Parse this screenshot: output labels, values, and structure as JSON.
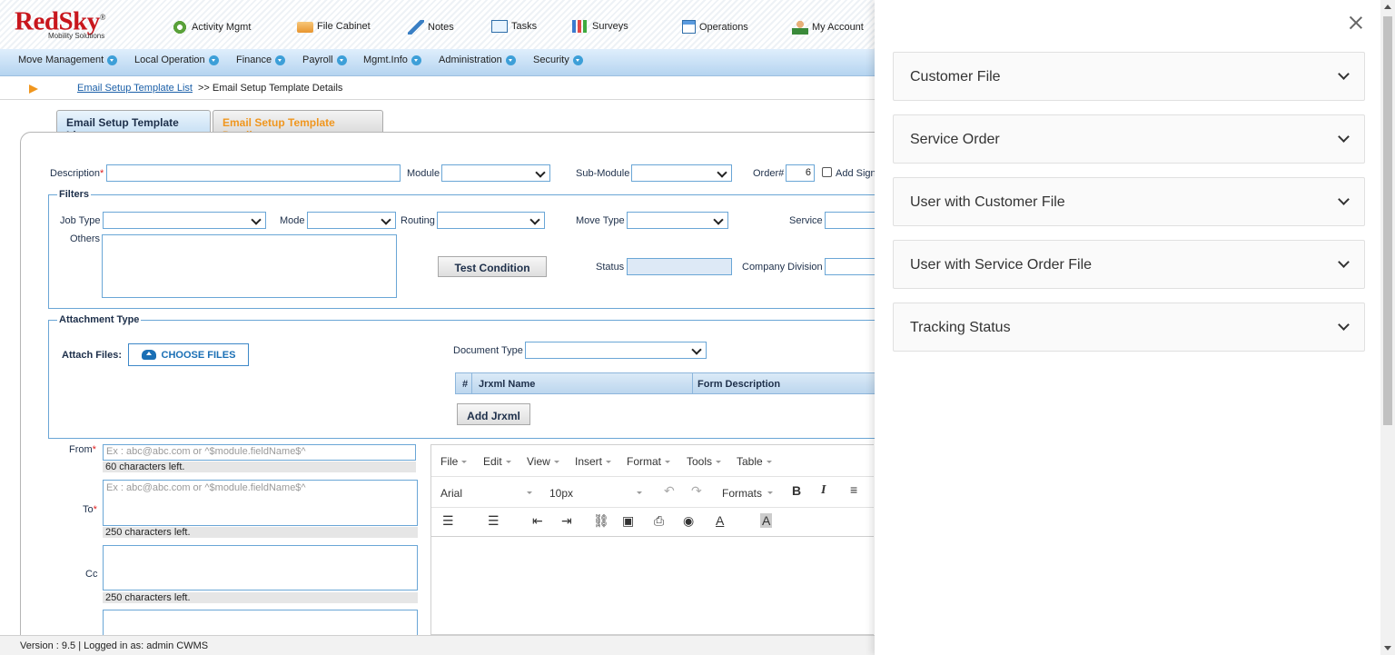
{
  "brand": {
    "name": "RedSky",
    "reg": "®",
    "tagline": "Mobility Solutions"
  },
  "topnav": [
    {
      "label": "Activity Mgmt",
      "icon": "gear-icon"
    },
    {
      "label": "File Cabinet",
      "icon": "folder-icon"
    },
    {
      "label": "Notes",
      "icon": "pencil-icon"
    },
    {
      "label": "Tasks",
      "icon": "tasks-icon"
    },
    {
      "label": "Surveys",
      "icon": "bar-chart-icon"
    },
    {
      "label": "Operations",
      "icon": "operations-icon"
    },
    {
      "label": "My Account",
      "icon": "user-icon"
    }
  ],
  "subnav": [
    "Move Management",
    "Local Operation",
    "Finance",
    "Payroll",
    "Mgmt.Info",
    "Administration",
    "Security"
  ],
  "breadcrumb": {
    "link": "Email Setup Template List",
    "current": ">> Email Setup Template Details"
  },
  "tabs": [
    "Email Setup Template List",
    "Email Setup Template Details"
  ],
  "form": {
    "description_label": "Description",
    "module_label": "Module",
    "submodule_label": "Sub-Module",
    "order_label": "Order#",
    "order_value": "6",
    "add_signature_label": "Add Sign",
    "filters_legend": "Filters",
    "job_type_label": "Job Type",
    "mode_label": "Mode",
    "routing_label": "Routing",
    "move_type_label": "Move Type",
    "service_label": "Service",
    "others_label": "Others",
    "test_condition_button": "Test Condition",
    "status_label": "Status",
    "company_division_label": "Company Division",
    "attachment_legend": "Attachment Type",
    "attach_files_label": "Attach Files:",
    "choose_files_button": "CHOOSE FILES",
    "document_type_label": "Document Type",
    "grid_headers": [
      "#",
      "Jrxml Name",
      "Form Description"
    ],
    "add_jrxml_button": "Add Jrxml",
    "from_label": "From",
    "from_placeholder": "Ex : abc@abc.com or ^$module.fieldName$^",
    "from_counter": "60   characters left.",
    "to_label": "To",
    "to_placeholder": "Ex : abc@abc.com or ^$module.fieldName$^",
    "to_counter": "250  characters left.",
    "cc_label": "Cc",
    "cc_counter": "250  characters left."
  },
  "editor": {
    "menus": [
      "File",
      "Edit",
      "View",
      "Insert",
      "Format",
      "Tools",
      "Table"
    ],
    "font": "Arial",
    "size": "10px",
    "formats": "Formats"
  },
  "footer": "Version : 9.5 | Logged in as: admin CWMS",
  "panel": {
    "sections": [
      "Customer File",
      "Service Order",
      "User with Customer File",
      "User with Service Order File",
      "Tracking Status"
    ]
  },
  "colors": {
    "brand_red": "#c8161d",
    "accent_orange": "#f0961e",
    "link_blue": "#1a5fa8"
  }
}
